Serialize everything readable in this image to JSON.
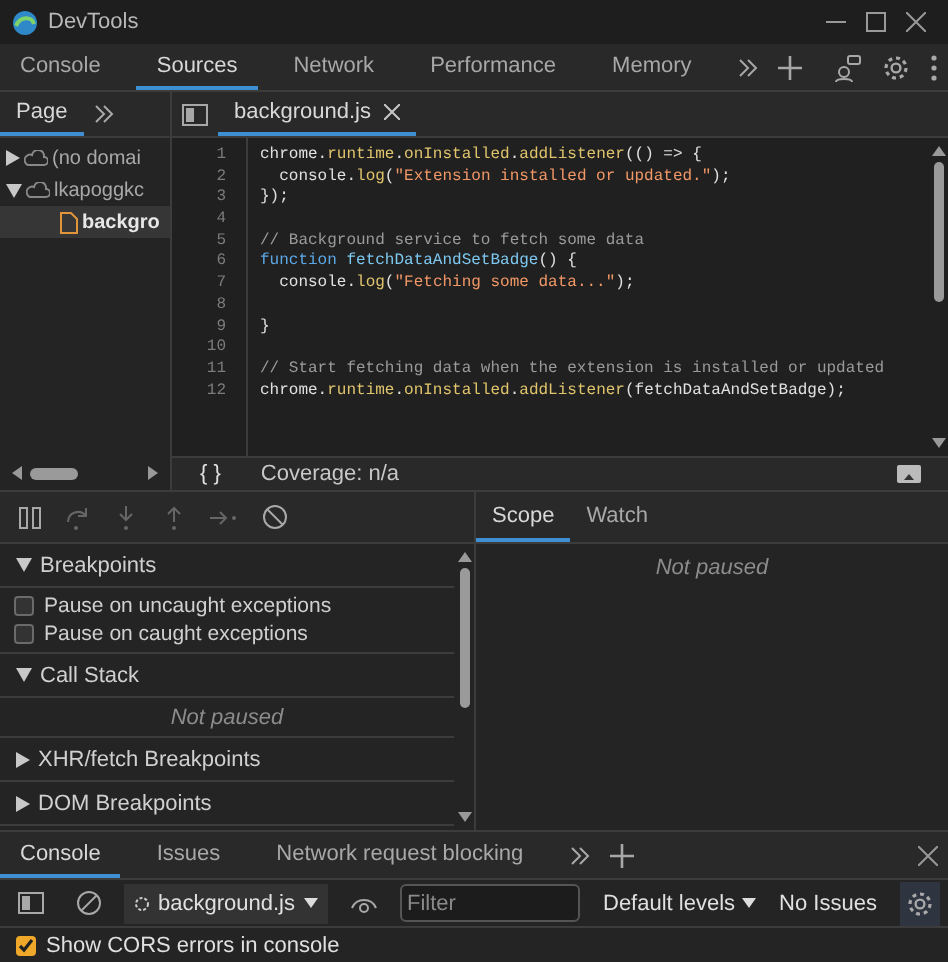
{
  "window": {
    "title": "DevTools"
  },
  "main_tabs": [
    {
      "label": "Console",
      "selected": false
    },
    {
      "label": "Sources",
      "selected": true
    },
    {
      "label": "Network",
      "selected": false
    },
    {
      "label": "Performance",
      "selected": false
    },
    {
      "label": "Memory",
      "selected": false
    }
  ],
  "navigator": {
    "tabs": [
      {
        "label": "Page",
        "selected": true
      }
    ],
    "tree": [
      {
        "label": "(no domai",
        "kind": "domain",
        "expanded": false,
        "selected": false
      },
      {
        "label": "lkapoggkc",
        "kind": "domain",
        "expanded": true,
        "selected": false,
        "children": [
          {
            "label": "backgro",
            "kind": "file",
            "selected": true
          }
        ]
      }
    ]
  },
  "editor": {
    "tabs": [
      {
        "label": "background.js",
        "selected": true
      }
    ],
    "lines": [
      {
        "number": "1",
        "tokens": [
          {
            "text": "chrome.",
            "kind": "plain"
          },
          {
            "text": "runtime",
            "kind": "prop"
          },
          {
            "text": ".",
            "kind": "plain"
          },
          {
            "text": "onInstalled",
            "kind": "prop"
          },
          {
            "text": ".",
            "kind": "plain"
          },
          {
            "text": "addListener",
            "kind": "prop"
          },
          {
            "text": "(() => {",
            "kind": "plain"
          }
        ]
      },
      {
        "number": "2",
        "tokens": [
          {
            "text": "  console.",
            "kind": "plain"
          },
          {
            "text": "log",
            "kind": "prop"
          },
          {
            "text": "(",
            "kind": "plain"
          },
          {
            "text": "\"Extension installed or updated.\"",
            "kind": "string"
          },
          {
            "text": ");",
            "kind": "plain"
          }
        ]
      },
      {
        "number": "3",
        "tokens": [
          {
            "text": "});",
            "kind": "plain"
          }
        ]
      },
      {
        "number": "4"
      },
      {
        "number": "5",
        "tokens": [
          {
            "text": "// Background service to fetch some data",
            "kind": "comment"
          }
        ]
      },
      {
        "number": "6",
        "tokens": [
          {
            "text": "function ",
            "kind": "keyword"
          },
          {
            "text": "fetchDataAndSetBadge",
            "kind": "def"
          },
          {
            "text": "() {",
            "kind": "plain"
          }
        ]
      },
      {
        "number": "7",
        "tokens": [
          {
            "text": "  console.",
            "kind": "plain"
          },
          {
            "text": "log",
            "kind": "prop"
          },
          {
            "text": "(",
            "kind": "plain"
          },
          {
            "text": "\"Fetching some data...\"",
            "kind": "string"
          },
          {
            "text": ");",
            "kind": "plain"
          }
        ]
      },
      {
        "number": "8"
      },
      {
        "number": "9",
        "tokens": [
          {
            "text": "}",
            "kind": "plain"
          }
        ]
      },
      {
        "number": "10"
      },
      {
        "number": "11",
        "tokens": [
          {
            "text": "// Start fetching data when the extension is installed or updated",
            "kind": "comment"
          }
        ]
      },
      {
        "number": "12",
        "tokens": [
          {
            "text": "chrome.",
            "kind": "plain"
          },
          {
            "text": "runtime",
            "kind": "prop"
          },
          {
            "text": ".",
            "kind": "plain"
          },
          {
            "text": "onInstalled",
            "kind": "prop"
          },
          {
            "text": ".",
            "kind": "plain"
          },
          {
            "text": "addListener",
            "kind": "prop"
          },
          {
            "text": "(fetchDataAndSetBadge);",
            "kind": "plain"
          }
        ]
      }
    ],
    "pretty_print": "{ }",
    "coverage": "Coverage: n/a"
  },
  "debugger": {
    "sections": [
      {
        "title": "Breakpoints",
        "expanded": true,
        "checkboxes": [
          {
            "label": "Pause on uncaught exceptions",
            "checked": false
          },
          {
            "label": "Pause on caught exceptions",
            "checked": false
          }
        ]
      },
      {
        "title": "Call Stack",
        "expanded": true,
        "message": "Not paused"
      },
      {
        "title": "XHR/fetch Breakpoints",
        "expanded": false
      },
      {
        "title": "DOM Breakpoints",
        "expanded": false
      }
    ]
  },
  "scope": {
    "tabs": [
      {
        "label": "Scope",
        "selected": true
      },
      {
        "label": "Watch",
        "selected": false
      }
    ],
    "message": "Not paused"
  },
  "drawer": {
    "tabs": [
      {
        "label": "Console",
        "selected": true
      },
      {
        "label": "Issues",
        "selected": false
      },
      {
        "label": "Network request blocking",
        "selected": false
      }
    ],
    "context": "background.js",
    "filter": {
      "placeholder": "Filter"
    },
    "levels": "Default levels",
    "issues": "No Issues",
    "cors": {
      "label": "Show CORS errors in console",
      "checked": true
    }
  }
}
